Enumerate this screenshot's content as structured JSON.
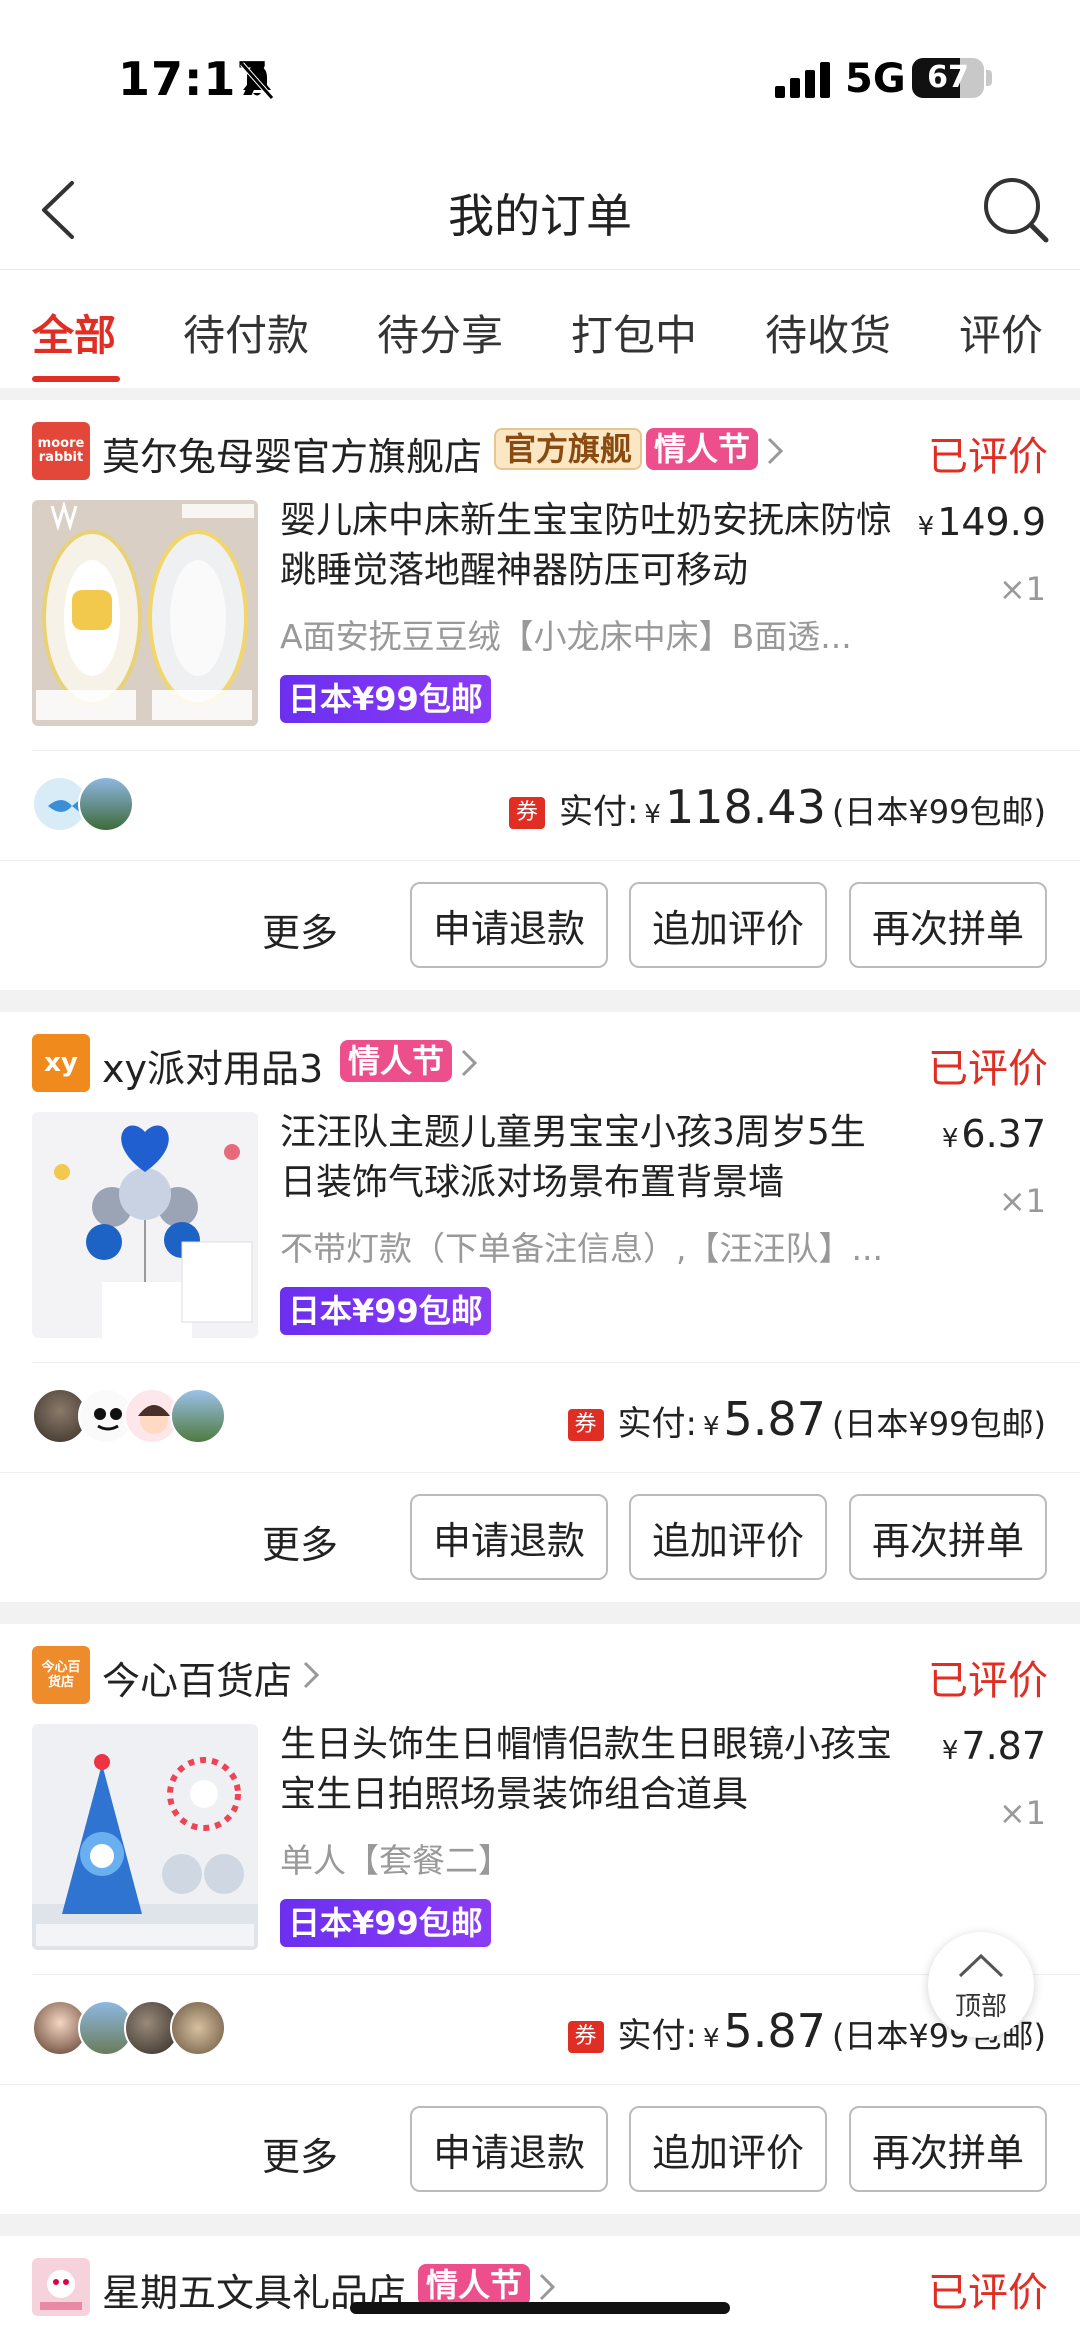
{
  "status_bar": {
    "time": "17:17",
    "network": "5G",
    "battery": "67",
    "battery_level_percent": 67
  },
  "nav": {
    "title": "我的订单"
  },
  "tabs": [
    {
      "label": "全部",
      "active": true
    },
    {
      "label": "待付款"
    },
    {
      "label": "待分享"
    },
    {
      "label": "打包中"
    },
    {
      "label": "待收货"
    },
    {
      "label": "评价"
    }
  ],
  "orders": [
    {
      "shop_name": "莫尔兔母婴官方旗舰店",
      "shop_logo_text": "moore rabbit",
      "tags": [
        "官方旗舰",
        "情人节"
      ],
      "status": "已评价",
      "product_name": "婴儿床中床新生宝宝防吐奶安抚床防惊跳睡觉落地醒神器防压可移动",
      "variant": "A面安抚豆豆绒【小龙床中床】B面透...",
      "shipping_badge": "日本¥99包邮",
      "price": "149.9",
      "currency": "¥",
      "qty": "×1",
      "paid_label": "实付:",
      "paid_amount": "118.43",
      "paid_note": "(日本¥99包邮)",
      "coupon": "券",
      "more": "更多",
      "buttons": [
        "申请退款",
        "追加评价",
        "再次拼单"
      ]
    },
    {
      "shop_name": "xy派对用品3",
      "shop_logo_text": "xy",
      "tags": [
        "情人节"
      ],
      "status": "已评价",
      "product_name": "汪汪队主题儿童男宝宝小孩3周岁5生日装饰气球派对场景布置背景墙",
      "variant": "不带灯款（下单备注信息）,【汪汪队】...",
      "shipping_badge": "日本¥99包邮",
      "price": "6.37",
      "currency": "¥",
      "qty": "×1",
      "paid_label": "实付:",
      "paid_amount": "5.87",
      "paid_note": "(日本¥99包邮)",
      "coupon": "券",
      "more": "更多",
      "buttons": [
        "申请退款",
        "追加评价",
        "再次拼单"
      ]
    },
    {
      "shop_name": "今心百货店",
      "shop_logo_text": "今心百货店",
      "tags": [],
      "status": "已评价",
      "product_name": "生日头饰生日帽情侣款生日眼镜小孩宝宝生日拍照场景装饰组合道具",
      "variant": "单人【套餐二】",
      "shipping_badge": "日本¥99包邮",
      "price": "7.87",
      "currency": "¥",
      "qty": "×1",
      "paid_label": "实付:",
      "paid_amount": "5.87",
      "paid_note": "(日本¥99包邮)",
      "coupon": "券",
      "more": "更多",
      "buttons": [
        "申请退款",
        "追加评价",
        "再次拼单"
      ]
    },
    {
      "shop_name": "星期五文具礼品店",
      "tags": [
        "情人节"
      ],
      "status": "已评价"
    }
  ],
  "fab": {
    "label": "顶部"
  },
  "colors": {
    "accent": "#e02e24",
    "valentine": "#ec4f8b",
    "shipping": "#7a35f3"
  }
}
